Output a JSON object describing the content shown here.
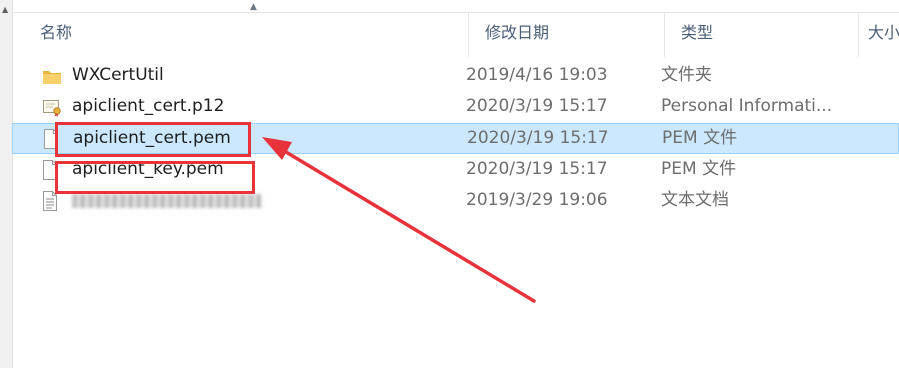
{
  "columns": {
    "name": "名称",
    "date": "修改日期",
    "type": "类型",
    "size": "大小"
  },
  "files": [
    {
      "name": "WXCertUtil",
      "date": "2019/4/16 19:03",
      "type": "文件夹",
      "icon": "folder-icon"
    },
    {
      "name": "apiclient_cert.p12",
      "date": "2020/3/19 15:17",
      "type": "Personal Informati...",
      "icon": "certificate-icon"
    },
    {
      "name": "apiclient_cert.pem",
      "date": "2020/3/19 15:17",
      "type": "PEM 文件",
      "icon": "file-icon",
      "selected": true
    },
    {
      "name": "apiclient_key.pem",
      "date": "2020/3/19 15:17",
      "type": "PEM 文件",
      "icon": "file-icon"
    },
    {
      "name": "",
      "date": "2019/3/29 19:06",
      "type": "文本文档",
      "icon": "text-document-icon",
      "blurred": true
    }
  ],
  "colors": {
    "selection_bg": "#cce8ff",
    "selection_border": "#99d1ff",
    "header_text": "#4c607a",
    "annotation_red": "#e8333a",
    "folder": "#f4c552"
  }
}
